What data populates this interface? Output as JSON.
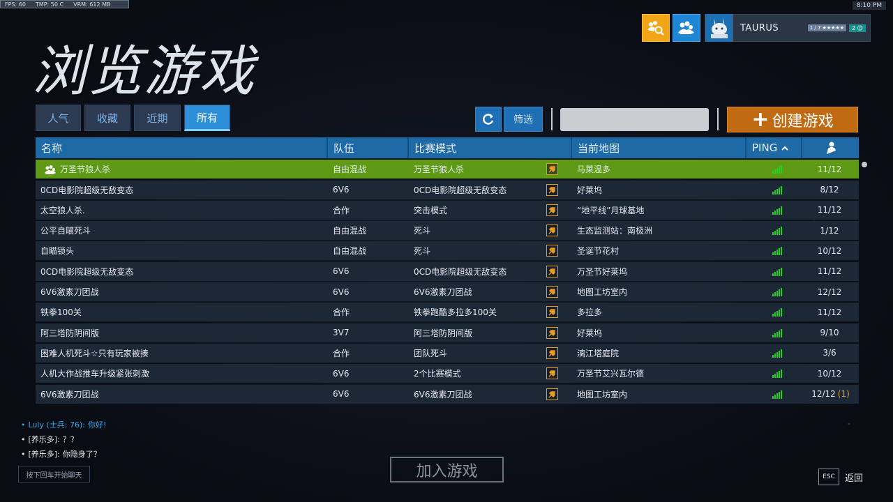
{
  "perf": {
    "fps": "FPS:  60",
    "tmp": "TMP:  50 C",
    "vrm": "VRM:  612 MB"
  },
  "clock": "8:10 PM",
  "profile": {
    "name": "TAURUS",
    "rank": "1 / 7 ★★★★★",
    "level": "2 ☺"
  },
  "title": "浏览游戏",
  "tabs": [
    {
      "label": "人气",
      "active": false
    },
    {
      "label": "收藏",
      "active": false
    },
    {
      "label": "近期",
      "active": false
    },
    {
      "label": "所有",
      "active": true
    }
  ],
  "toolbar": {
    "filter": "筛选",
    "search_value": "",
    "create": "创建游戏"
  },
  "columns": {
    "name": "名称",
    "team": "队伍",
    "mode": "比赛模式",
    "map": "当前地图",
    "ping": "PING"
  },
  "rows": [
    {
      "name": "万圣节狼人杀",
      "team": "自由混战",
      "mode": "万圣节狼人杀",
      "map": "马莱温多",
      "players": "11/12",
      "extra": "",
      "favorite": true,
      "selected": true
    },
    {
      "name": "0CD电影院超级无敌变态",
      "team": "6V6",
      "mode": "0CD电影院超级无敌变态",
      "map": "好莱坞",
      "players": "8/12",
      "extra": ""
    },
    {
      "name": "太空狼人杀.",
      "team": "合作",
      "mode": "突击模式",
      "map": "“地平线”月球基地",
      "players": "11/12",
      "extra": ""
    },
    {
      "name": "公平自瞄死斗",
      "team": "自由混战",
      "mode": "死斗",
      "map": "生态监测站：南极洲",
      "players": "1/12",
      "extra": ""
    },
    {
      "name": "自瞄锁头",
      "team": "自由混战",
      "mode": "死斗",
      "map": "圣诞节花村",
      "players": "10/12",
      "extra": ""
    },
    {
      "name": "0CD电影院超级无敌变态",
      "team": "6V6",
      "mode": "0CD电影院超级无敌变态",
      "map": "万圣节好莱坞",
      "players": "11/12",
      "extra": ""
    },
    {
      "name": "6V6激素刀团战",
      "team": "6V6",
      "mode": "6V6激素刀团战",
      "map": "地图工坊室内",
      "players": "12/12",
      "extra": ""
    },
    {
      "name": "铁拳100关",
      "team": "合作",
      "mode": "铁拳跑酷多拉多100关",
      "map": "多拉多",
      "players": "11/12",
      "extra": ""
    },
    {
      "name": "阿三塔防阴间版",
      "team": "3V7",
      "mode": "阿三塔防阴间版",
      "map": "好莱坞",
      "players": "9/10",
      "extra": ""
    },
    {
      "name": "困难人机死斗☆只有玩家被揍",
      "team": "合作",
      "mode": "团队死斗",
      "map": "漓江塔庭院",
      "players": "3/6",
      "extra": ""
    },
    {
      "name": "人机大作战推车升级紧张刺激",
      "team": "6V6",
      "mode": "2个比赛模式",
      "map": "万圣节艾兴瓦尔德",
      "players": "10/12",
      "extra": ""
    },
    {
      "name": "6V6激素刀团战",
      "team": "6V6",
      "mode": "6V6激素刀团战",
      "map": "地图工坊室内",
      "players": "12/12",
      "extra": "(1)"
    }
  ],
  "chat": [
    {
      "prefix": "•",
      "speaker": "Luly (士兵: 76):",
      "message": "你好!",
      "color": "#3aa6e8"
    },
    {
      "prefix": "•",
      "speaker": "[养乐多]:",
      "message": "？？",
      "color": "#e5e9ee"
    },
    {
      "prefix": "•",
      "speaker": "[养乐多]:",
      "message": "你隐身了？",
      "color": "#e5e9ee"
    }
  ],
  "chat_hint": "按下回车开始聊天",
  "join": "加入游戏",
  "esc": "ESC",
  "back": "返回"
}
